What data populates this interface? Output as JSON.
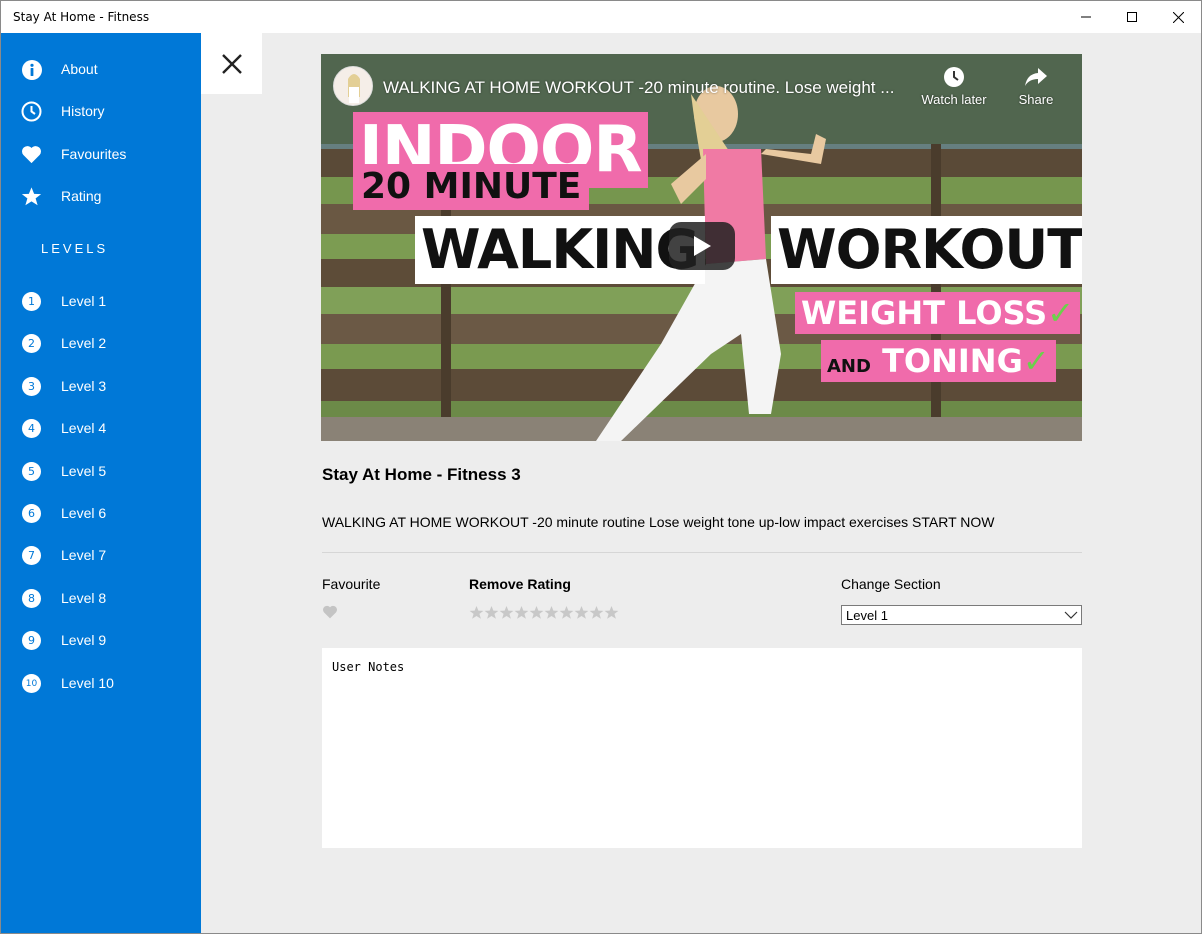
{
  "window": {
    "title": "Stay At Home - Fitness"
  },
  "sidebar": {
    "items": [
      {
        "label": "About",
        "icon": "info-icon"
      },
      {
        "label": "History",
        "icon": "clock-icon"
      },
      {
        "label": "Favourites",
        "icon": "heart-icon"
      },
      {
        "label": "Rating",
        "icon": "star-icon"
      }
    ],
    "levels_heading": "LEVELS",
    "levels": [
      {
        "num": "1",
        "label": "Level 1"
      },
      {
        "num": "2",
        "label": "Level 2"
      },
      {
        "num": "3",
        "label": "Level 3"
      },
      {
        "num": "4",
        "label": "Level 4"
      },
      {
        "num": "5",
        "label": "Level 5"
      },
      {
        "num": "6",
        "label": "Level 6"
      },
      {
        "num": "7",
        "label": "Level 7"
      },
      {
        "num": "8",
        "label": "Level 8"
      },
      {
        "num": "9",
        "label": "Level 9"
      },
      {
        "num": "10",
        "label": "Level 10"
      }
    ]
  },
  "video": {
    "title": "WALKING AT HOME WORKOUT -20 minute routine. Lose weight ...",
    "watch_later": "Watch later",
    "share": "Share",
    "thumb_text": {
      "line1": "INDOOR",
      "line2": "20 MINUTE",
      "line3a": "WALKING",
      "line3b": "WORKOUT",
      "line4": "WEIGHT LOSS",
      "line5a": "AND",
      "line5b": "TONING"
    }
  },
  "detail": {
    "title": "Stay At Home - Fitness 3",
    "description": "WALKING AT HOME WORKOUT -20 minute routine Lose weight tone up-low impact exercises START NOW",
    "favourite_label": "Favourite",
    "remove_rating_label": "Remove Rating",
    "rating": {
      "value": 0,
      "max": 10
    },
    "change_section_label": "Change Section",
    "section_selected": "Level 1",
    "notes_placeholder": "User Notes"
  },
  "colors": {
    "sidebar": "#0078d7",
    "background": "#ededed",
    "thumb_pink": "#f06bab",
    "inactive_star": "#c8c8c8"
  }
}
